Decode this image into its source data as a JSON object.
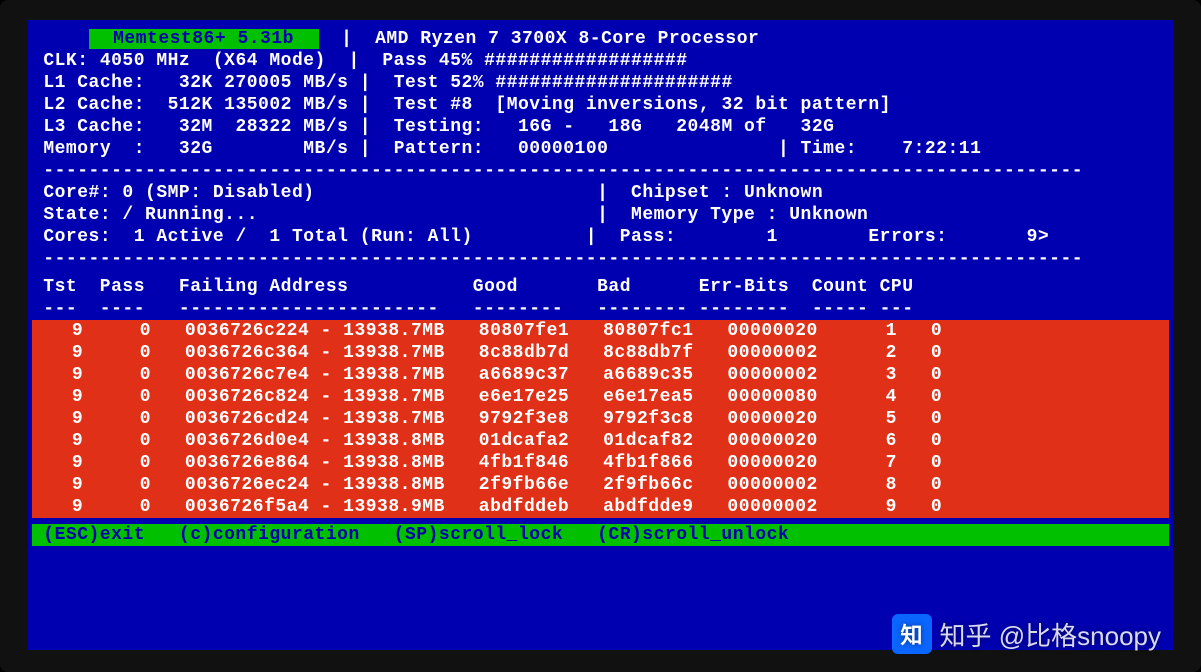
{
  "title": "  Memtest86+ 5.31b  ",
  "cpu": "AMD Ryzen 7 3700X 8-Core Processor",
  "clk_line": "CLK: 4050 MHz  (X64 Mode)",
  "pass_line": "Pass 45% ##################",
  "l1": "L1 Cache:   32K 270005 MB/s",
  "test_pct": "Test 52% #####################",
  "l2": "L2 Cache:  512K 135002 MB/s",
  "test_desc": "Test #8  [Moving inversions, 32 bit pattern]",
  "l3": "L3 Cache:   32M  28322 MB/s",
  "testing": "Testing:   16G -   18G   2048M of   32G",
  "mem": "Memory  :   32G        MB/s",
  "pattern": "Pattern:   00000100               | Time:    7:22:11",
  "core_line": "Core#: 0 (SMP: Disabled)",
  "chipset": "Chipset : Unknown",
  "state": "State: / Running...",
  "memtype": "Memory Type : Unknown",
  "cores": "Cores:  1 Active /  1 Total (Run: All)",
  "pass_err": "Pass:        1        Errors:       9>",
  "header": " Tst  Pass   Failing Address           Good       Bad      Err-Bits  Count CPU",
  "header2": " ---  ----   -----------------------   --------   -------- --------  ----- ---",
  "errors": [
    {
      "tst": "9",
      "pass": "0",
      "addr": "0036726c224",
      "mb": "13938.7MB",
      "good": "80807fe1",
      "bad": "80807fc1",
      "bits": "00000020",
      "cnt": "1",
      "cpu": "0"
    },
    {
      "tst": "9",
      "pass": "0",
      "addr": "0036726c364",
      "mb": "13938.7MB",
      "good": "8c88db7d",
      "bad": "8c88db7f",
      "bits": "00000002",
      "cnt": "2",
      "cpu": "0"
    },
    {
      "tst": "9",
      "pass": "0",
      "addr": "0036726c7e4",
      "mb": "13938.7MB",
      "good": "a6689c37",
      "bad": "a6689c35",
      "bits": "00000002",
      "cnt": "3",
      "cpu": "0"
    },
    {
      "tst": "9",
      "pass": "0",
      "addr": "0036726c824",
      "mb": "13938.7MB",
      "good": "e6e17e25",
      "bad": "e6e17ea5",
      "bits": "00000080",
      "cnt": "4",
      "cpu": "0"
    },
    {
      "tst": "9",
      "pass": "0",
      "addr": "0036726cd24",
      "mb": "13938.7MB",
      "good": "9792f3e8",
      "bad": "9792f3c8",
      "bits": "00000020",
      "cnt": "5",
      "cpu": "0"
    },
    {
      "tst": "9",
      "pass": "0",
      "addr": "0036726d0e4",
      "mb": "13938.8MB",
      "good": "01dcafa2",
      "bad": "01dcaf82",
      "bits": "00000020",
      "cnt": "6",
      "cpu": "0"
    },
    {
      "tst": "9",
      "pass": "0",
      "addr": "0036726e864",
      "mb": "13938.8MB",
      "good": "4fb1f846",
      "bad": "4fb1f866",
      "bits": "00000020",
      "cnt": "7",
      "cpu": "0"
    },
    {
      "tst": "9",
      "pass": "0",
      "addr": "0036726ec24",
      "mb": "13938.8MB",
      "good": "2f9fb66e",
      "bad": "2f9fb66c",
      "bits": "00000002",
      "cnt": "8",
      "cpu": "0"
    },
    {
      "tst": "9",
      "pass": "0",
      "addr": "0036726f5a4",
      "mb": "13938.9MB",
      "good": "abdfddeb",
      "bad": "abdfdde9",
      "bits": "00000002",
      "cnt": "9",
      "cpu": "0"
    }
  ],
  "footer": " (ESC)exit   (c)configuration   (SP)scroll_lock   (CR)scroll_unlock",
  "watermark": "知乎 @比格snoopy",
  "zhi_icon": "知"
}
